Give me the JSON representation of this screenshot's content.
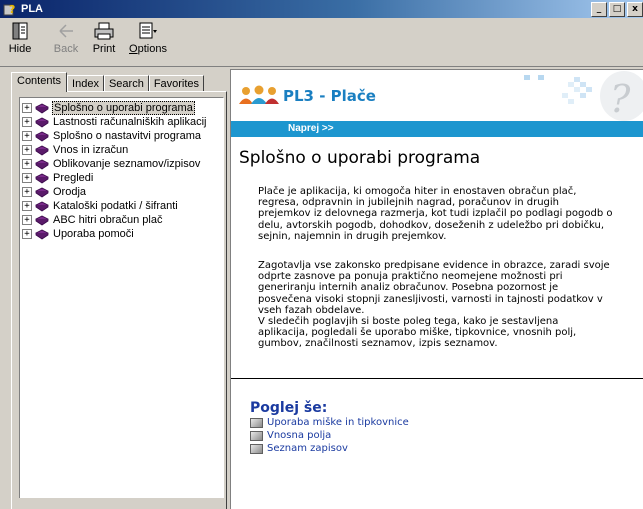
{
  "window": {
    "title": "PLA",
    "minimize": "_",
    "maximize": "□",
    "close": "x"
  },
  "toolbar": {
    "hide": "Hide",
    "back": "Back",
    "print": "Print",
    "options": "Options"
  },
  "tabs": [
    "Contents",
    "Index",
    "Search",
    "Favorites"
  ],
  "tree": [
    "Splošno o uporabi programa",
    "Lastnosti računalniških aplikacij",
    "Splošno o nastavitvi programa",
    "Vnos in izračun",
    "Oblikovanje seznamov/izpisov",
    "Pregledi",
    "Orodja",
    "Kataloški podatki / šifranti",
    "ABC hitri obračun plač",
    "Uporaba pomoči"
  ],
  "banner": {
    "brand": "PL3 - Plače",
    "next": "Naprej >>"
  },
  "page": {
    "heading": "Splošno o uporabi programa",
    "para1": "Plače je aplikacija, ki omogoča hiter in enostaven obračun plač,\nregresa, odpravnin in jubilejnih nagrad, poračunov in drugih\nprejemkov iz delovnega razmerja, kot tudi izplačil po podlagi pogodb o\ndelu, avtorskih pogodb, dohodkov, doseženih z udeležbo pri dobičku,\nsejnin, najemnin in drugih prejemkov.",
    "para2": "Zagotavlja vse zakonsko predpisane evidence in obrazce, zaradi svoje\nodprte zasnove pa ponuja praktično neomejene možnosti pri\ngeneriranju internih analiz obračunov. Posebna pozornost je\nposvečena visoki stopnji zanesljivosti, varnosti in tajnosti podatkov v\nvseh fazah obdelave.\nV sledečih poglavjih si boste poleg tega, kako je sestavljena\naplikacija, pogledali še uporabo miške, tipkovnice, vnosnih polj,\ngumbov, značilnosti seznamov, izpis seznamov.",
    "see_also": "Poglej še:",
    "links": [
      "Uporaba miške in tipkovnice",
      "Vnosna polja",
      "Seznam zapisov"
    ]
  },
  "colors": {
    "accent": "#1d96cf",
    "link": "#1a3aa0",
    "brand": "#1a7fc1"
  }
}
